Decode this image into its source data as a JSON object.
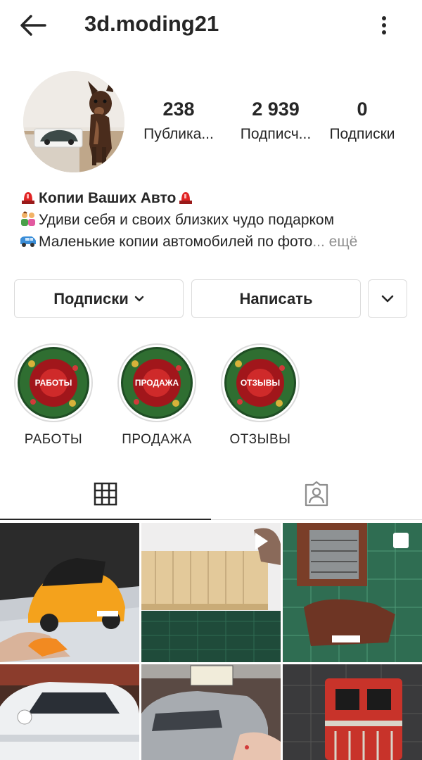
{
  "header": {
    "username": "3d.moding21",
    "back_icon": "arrow-left-icon",
    "menu_icon": "more-vertical-icon"
  },
  "stats": [
    {
      "value": "238",
      "label": "Публика..."
    },
    {
      "value": "2 939",
      "label": "Подписч..."
    },
    {
      "value": "0",
      "label": "Подписки"
    }
  ],
  "bio": {
    "line1": "Копии Ваших Авто",
    "line2": "Удиви себя и своих близких чудо подарком",
    "line3": "Маленькие копии  автомобилей по фото",
    "more": "... ещё"
  },
  "actions": {
    "subscriptions": "Подписки",
    "message": "Написать"
  },
  "highlights": [
    {
      "badge": "РАБОТЫ",
      "caption": "РАБОТЫ"
    },
    {
      "badge": "ПРОДАЖА",
      "caption": "ПРОДАЖА"
    },
    {
      "badge": "ОТЗЫВЫ",
      "caption": "ОТЗЫВЫ"
    }
  ],
  "tabs": {
    "grid_icon": "grid-icon",
    "tagged_icon": "tagged-person-icon"
  },
  "colors": {
    "text": "#262626",
    "secondary": "#8e8e8e",
    "border": "#dbdbdb"
  }
}
